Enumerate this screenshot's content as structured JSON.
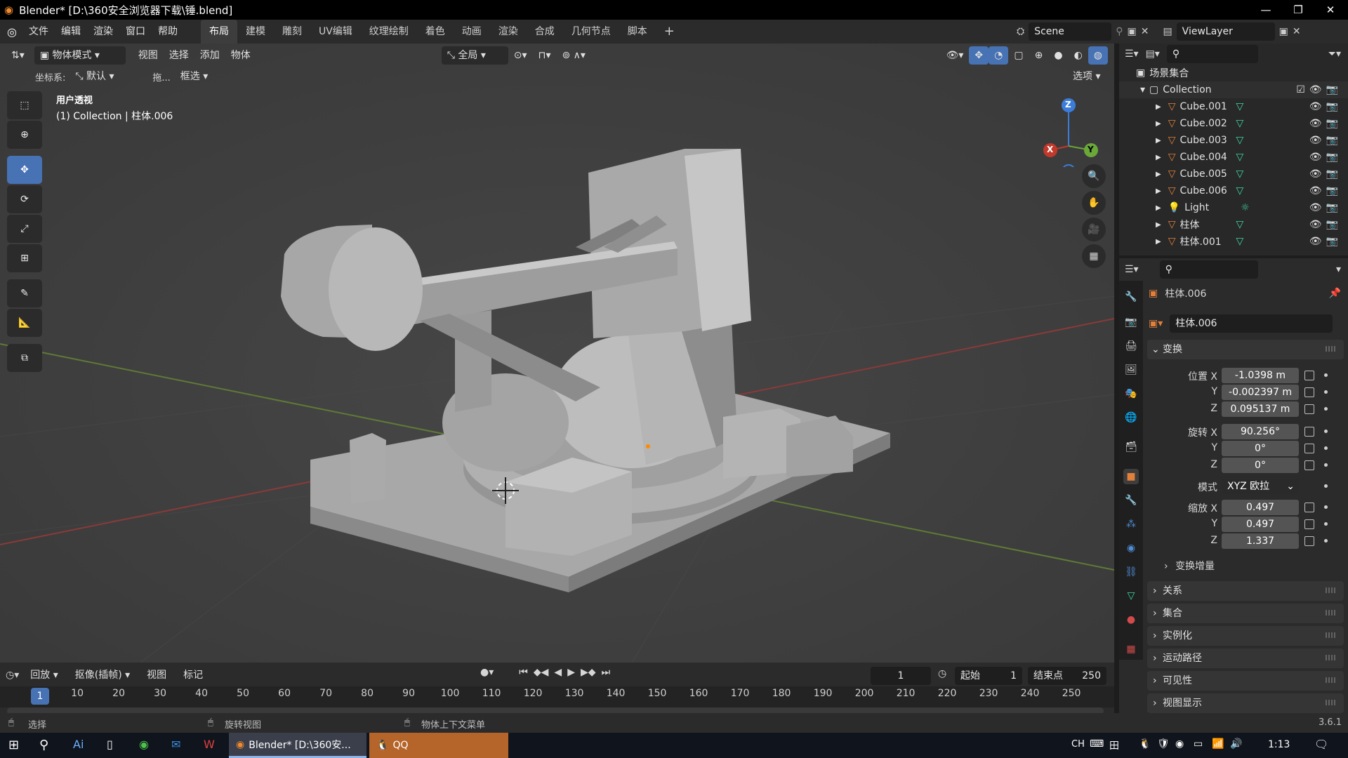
{
  "window": {
    "title": "Blender* [D:\\360安全浏览器下载\\锤.blend]"
  },
  "menus": [
    "文件",
    "编辑",
    "渲染",
    "窗口",
    "帮助"
  ],
  "workspaces": [
    "布局",
    "建模",
    "雕刻",
    "UV编辑",
    "纹理绘制",
    "着色",
    "动画",
    "渲染",
    "合成",
    "几何节点",
    "脚本"
  ],
  "active_workspace": "布局",
  "scene": {
    "label": "Scene",
    "view_layer": "ViewLayer"
  },
  "viewport": {
    "mode": "物体模式",
    "menus": [
      "视图",
      "选择",
      "添加",
      "物体"
    ],
    "transform_orientation": "全局",
    "coord_label": "坐标系:",
    "coord_value": "默认",
    "drag_label": "拖...",
    "drag_value": "框选",
    "options_label": "选项",
    "view_name": "用户透视",
    "view_context": "(1) Collection | 柱体.006",
    "gizmo_axes": [
      "Z",
      "Y",
      "X"
    ]
  },
  "outliner": {
    "root": "场景集合",
    "collection": "Collection",
    "items": [
      {
        "name": "Cube.001",
        "type": "mesh"
      },
      {
        "name": "Cube.002",
        "type": "mesh"
      },
      {
        "name": "Cube.003",
        "type": "mesh"
      },
      {
        "name": "Cube.004",
        "type": "mesh"
      },
      {
        "name": "Cube.005",
        "type": "mesh"
      },
      {
        "name": "Cube.006",
        "type": "mesh"
      },
      {
        "name": "Light",
        "type": "light"
      },
      {
        "name": "柱体",
        "type": "mesh"
      },
      {
        "name": "柱体.001",
        "type": "mesh"
      }
    ]
  },
  "properties": {
    "object_name": "柱体.006",
    "object_field": "柱体.006",
    "transform_section": "变换",
    "location_label": "位置 X",
    "location": [
      "-1.0398 m",
      "-0.002397 m",
      "0.095137 m"
    ],
    "rotation_label": "旋转 X",
    "rotation": [
      "90.256°",
      "0°",
      "0°"
    ],
    "mode_label": "模式",
    "mode_value": "XYZ 欧拉",
    "scale_label": "缩放 X",
    "scale": [
      "0.497",
      "0.497",
      "1.337"
    ],
    "axis_y": "Y",
    "axis_z": "Z",
    "delta": "变换增量",
    "sections": [
      "关系",
      "集合",
      "实例化",
      "运动路径",
      "可见性",
      "视图显示"
    ]
  },
  "timeline": {
    "playback": "回放",
    "keying": "抠像(插帧)",
    "view": "视图",
    "marker": "标记",
    "current_frame": "1",
    "start_label": "起始",
    "start": "1",
    "end_label": "结束点",
    "end": "250",
    "ticks": [
      "10",
      "20",
      "30",
      "40",
      "50",
      "60",
      "70",
      "80",
      "90",
      "100",
      "110",
      "120",
      "130",
      "140",
      "150",
      "160",
      "170",
      "180",
      "190",
      "200",
      "210",
      "220",
      "230",
      "240",
      "250"
    ]
  },
  "status": {
    "select": "选择",
    "rotate": "旋转视图",
    "context": "物体上下文菜单",
    "version": "3.6.1"
  },
  "taskbar": {
    "blender_label": "Blender* [D:\\360安...",
    "qq_label": "QQ",
    "ime": "CH",
    "time": "1:13"
  },
  "colors": {
    "accent": "#4772b3",
    "mesh_icon": "#e0803a",
    "vertex_icon": "#3fd6a8",
    "taskbar_active": "#b5642a"
  }
}
